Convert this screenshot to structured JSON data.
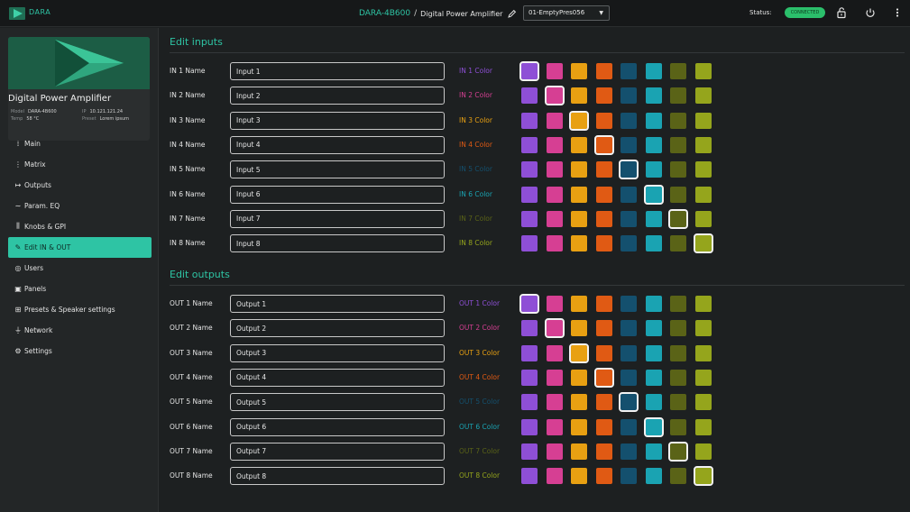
{
  "topbar": {
    "logo_text": "DARA",
    "device_name": "DARA-4B600",
    "separator": "/",
    "device_desc": "Digital Power Amplifier",
    "preset_value": "01-EmptyPres056",
    "status_label": "Status:",
    "status_badge": "CONNECTED",
    "icons": [
      "unlock-icon",
      "power-icon",
      "more-vertical-icon"
    ]
  },
  "device_card": {
    "title": "Digital Power Amplifier",
    "model_label": "Model",
    "model": "DARA-4B600",
    "ip_label": "IP",
    "ip": "10.121.121.24",
    "temp_label": "Temp",
    "temp": "58 °C",
    "preset_label": "Preset",
    "preset": "Lorem ipsum"
  },
  "nav": [
    {
      "label": "Main",
      "icon": "sliders-icon",
      "glyph": "⁞",
      "active": false
    },
    {
      "label": "Matrix",
      "icon": "grid-icon",
      "glyph": "⋮",
      "active": false
    },
    {
      "label": "Outputs",
      "icon": "output-arrow-icon",
      "glyph": "↦",
      "active": false
    },
    {
      "label": "Param. EQ",
      "icon": "eq-curve-icon",
      "glyph": "∼",
      "active": false
    },
    {
      "label": "Knobs & GPI",
      "icon": "knobs-icon",
      "glyph": "⫼",
      "active": false
    },
    {
      "label": "Edit IN & OUT",
      "icon": "pencil-icon",
      "glyph": "✎",
      "active": true
    },
    {
      "label": "Users",
      "icon": "user-circle-icon",
      "glyph": "◎",
      "active": false
    },
    {
      "label": "Panels",
      "icon": "panel-icon",
      "glyph": "▣",
      "active": false
    },
    {
      "label": "Presets  & Speaker settings",
      "icon": "preset-add-icon",
      "glyph": "⊞",
      "active": false
    },
    {
      "label": "Network",
      "icon": "network-icon",
      "glyph": "⏚",
      "active": false
    },
    {
      "label": "Settings",
      "icon": "gear-icon",
      "glyph": "⚙",
      "active": false
    }
  ],
  "palette": [
    "#8e4fd6",
    "#d63f93",
    "#e8a012",
    "#e05a14",
    "#14506e",
    "#1aa3b2",
    "#5a6317",
    "#95a51c"
  ],
  "inputs": {
    "title": "Edit inputs",
    "rows": [
      {
        "label": "IN 1 Name",
        "value": "Input 1",
        "color_label": "IN 1 Color",
        "selected": 0
      },
      {
        "label": "IN 2 Name",
        "value": "Input 2",
        "color_label": "IN 2 Color",
        "selected": 1
      },
      {
        "label": "IN 3 Name",
        "value": "Input 3",
        "color_label": "IN 3 Color",
        "selected": 2
      },
      {
        "label": "IN 4 Name",
        "value": "Input 4",
        "color_label": "IN 4 Color",
        "selected": 3
      },
      {
        "label": "IN 5 Name",
        "value": "Input 5",
        "color_label": "IN 5 Color",
        "selected": 4
      },
      {
        "label": "IN 6 Name",
        "value": "Input 6",
        "color_label": "IN 6 Color",
        "selected": 5
      },
      {
        "label": "IN 7 Name",
        "value": "Input 7",
        "color_label": "IN 7 Color",
        "selected": 6
      },
      {
        "label": "IN 8 Name",
        "value": "Input 8",
        "color_label": "IN 8 Color",
        "selected": 7
      }
    ]
  },
  "outputs": {
    "title": "Edit outputs",
    "rows": [
      {
        "label": "OUT 1 Name",
        "value": "Output 1",
        "color_label": "OUT 1 Color",
        "selected": 0
      },
      {
        "label": "OUT 2 Name",
        "value": "Output 2",
        "color_label": "OUT 2 Color",
        "selected": 1
      },
      {
        "label": "OUT 3 Name",
        "value": "Output 3",
        "color_label": "OUT 3 Color",
        "selected": 2
      },
      {
        "label": "OUT 4 Name",
        "value": "Output 4",
        "color_label": "OUT 4 Color",
        "selected": 3
      },
      {
        "label": "OUT 5 Name",
        "value": "Output 5",
        "color_label": "OUT 5 Color",
        "selected": 4
      },
      {
        "label": "OUT 6 Name",
        "value": "Output 6",
        "color_label": "OUT 6 Color",
        "selected": 5
      },
      {
        "label": "OUT 7 Name",
        "value": "Output 7",
        "color_label": "OUT 7 Color",
        "selected": 6
      },
      {
        "label": "OUT 8 Name",
        "value": "Output 8",
        "color_label": "OUT 8 Color",
        "selected": 7
      }
    ]
  }
}
